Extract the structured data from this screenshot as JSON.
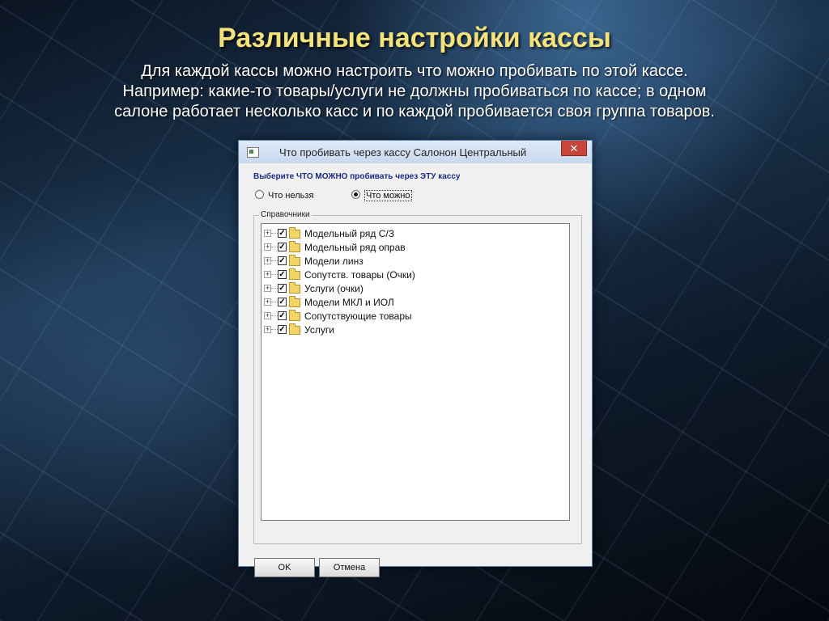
{
  "slide": {
    "title": "Различные настройки кассы",
    "lines": [
      "Для каждой кассы можно настроить что можно пробивать по этой кассе.",
      "Например: какие-то товары/услуги не должны пробиваться по кассе; в одном",
      "салоне работает несколько касс и по каждой пробивается своя группа товаров."
    ]
  },
  "dialog": {
    "title": "Что пробивать через кассу Салонон Центральный",
    "close_label": "✕",
    "prompt": "Выберите ЧТО МОЖНО пробивать через ЭТУ кассу",
    "radio_cannot": "Что нельзя",
    "radio_can": "Что можно",
    "selected_radio": "Что можно",
    "group_label": "Справочники",
    "tree_items": [
      {
        "label": "Модельный ряд С/З",
        "checked": true
      },
      {
        "label": "Модельный ряд оправ",
        "checked": true
      },
      {
        "label": "Модели линз",
        "checked": true
      },
      {
        "label": "Сопутств. товары (Очки)",
        "checked": true
      },
      {
        "label": "Услуги (очки)",
        "checked": true
      },
      {
        "label": "Модели МКЛ и ИОЛ",
        "checked": true
      },
      {
        "label": "Сопутствующие товары",
        "checked": true
      },
      {
        "label": "Услуги",
        "checked": true
      }
    ],
    "ok_label": "OK",
    "cancel_label": "Отмена"
  },
  "colors": {
    "title_accent": "#f5e27a",
    "prompt_color": "#1b2a80",
    "close_button": "#c7453a"
  }
}
